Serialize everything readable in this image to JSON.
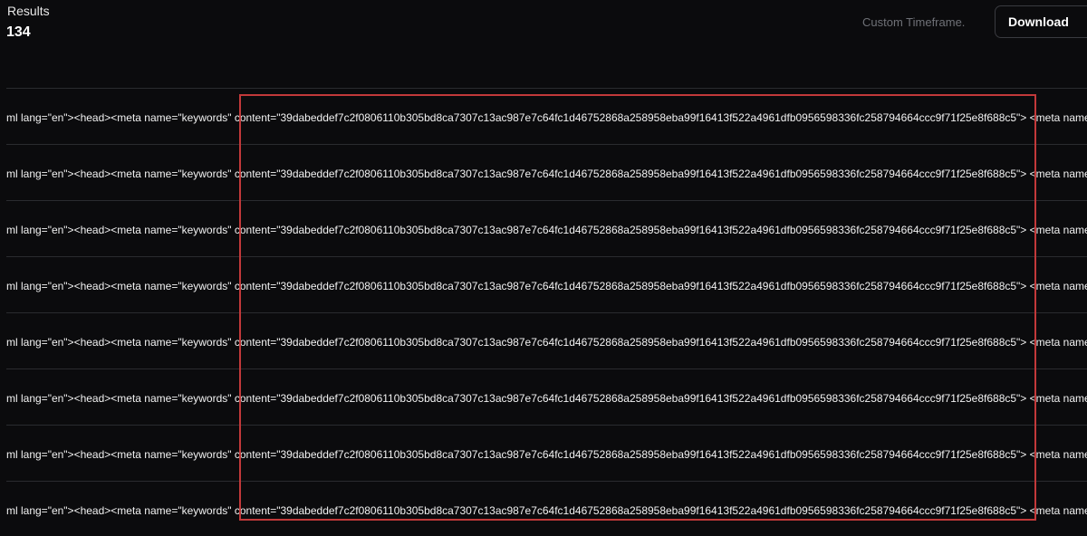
{
  "header": {
    "results_label": "Results",
    "results_count": "134",
    "timeframe_label": "Custom Timeframe.",
    "download_label": "Download"
  },
  "rows": [
    "ml lang=\"en\"><head><meta name=\"keywords\" content=\"39dabeddef7c2f0806110b305bd8ca7307c13ac987e7c64fc1d46752868a258958eba99f16413f522a4961dfb0956598336fc258794664ccc9f71f25e8f688c5\"> <meta name",
    "ml lang=\"en\"><head><meta name=\"keywords\" content=\"39dabeddef7c2f0806110b305bd8ca7307c13ac987e7c64fc1d46752868a258958eba99f16413f522a4961dfb0956598336fc258794664ccc9f71f25e8f688c5\"> <meta name",
    "ml lang=\"en\"><head><meta name=\"keywords\" content=\"39dabeddef7c2f0806110b305bd8ca7307c13ac987e7c64fc1d46752868a258958eba99f16413f522a4961dfb0956598336fc258794664ccc9f71f25e8f688c5\"> <meta name",
    "ml lang=\"en\"><head><meta name=\"keywords\" content=\"39dabeddef7c2f0806110b305bd8ca7307c13ac987e7c64fc1d46752868a258958eba99f16413f522a4961dfb0956598336fc258794664ccc9f71f25e8f688c5\"> <meta name",
    "ml lang=\"en\"><head><meta name=\"keywords\" content=\"39dabeddef7c2f0806110b305bd8ca7307c13ac987e7c64fc1d46752868a258958eba99f16413f522a4961dfb0956598336fc258794664ccc9f71f25e8f688c5\"> <meta name",
    "ml lang=\"en\"><head><meta name=\"keywords\" content=\"39dabeddef7c2f0806110b305bd8ca7307c13ac987e7c64fc1d46752868a258958eba99f16413f522a4961dfb0956598336fc258794664ccc9f71f25e8f688c5\"> <meta name",
    "ml lang=\"en\"><head><meta name=\"keywords\" content=\"39dabeddef7c2f0806110b305bd8ca7307c13ac987e7c64fc1d46752868a258958eba99f16413f522a4961dfb0956598336fc258794664ccc9f71f25e8f688c5\"> <meta name",
    "ml lang=\"en\"><head><meta name=\"keywords\" content=\"39dabeddef7c2f0806110b305bd8ca7307c13ac987e7c64fc1d46752868a258958eba99f16413f522a4961dfb0956598336fc258794664ccc9f71f25e8f688c5\"> <meta name"
  ],
  "colors": {
    "background": "#0b0b0d",
    "highlight": "#c2393a",
    "muted_text": "#6f7177",
    "divider": "#2a2b2f"
  }
}
